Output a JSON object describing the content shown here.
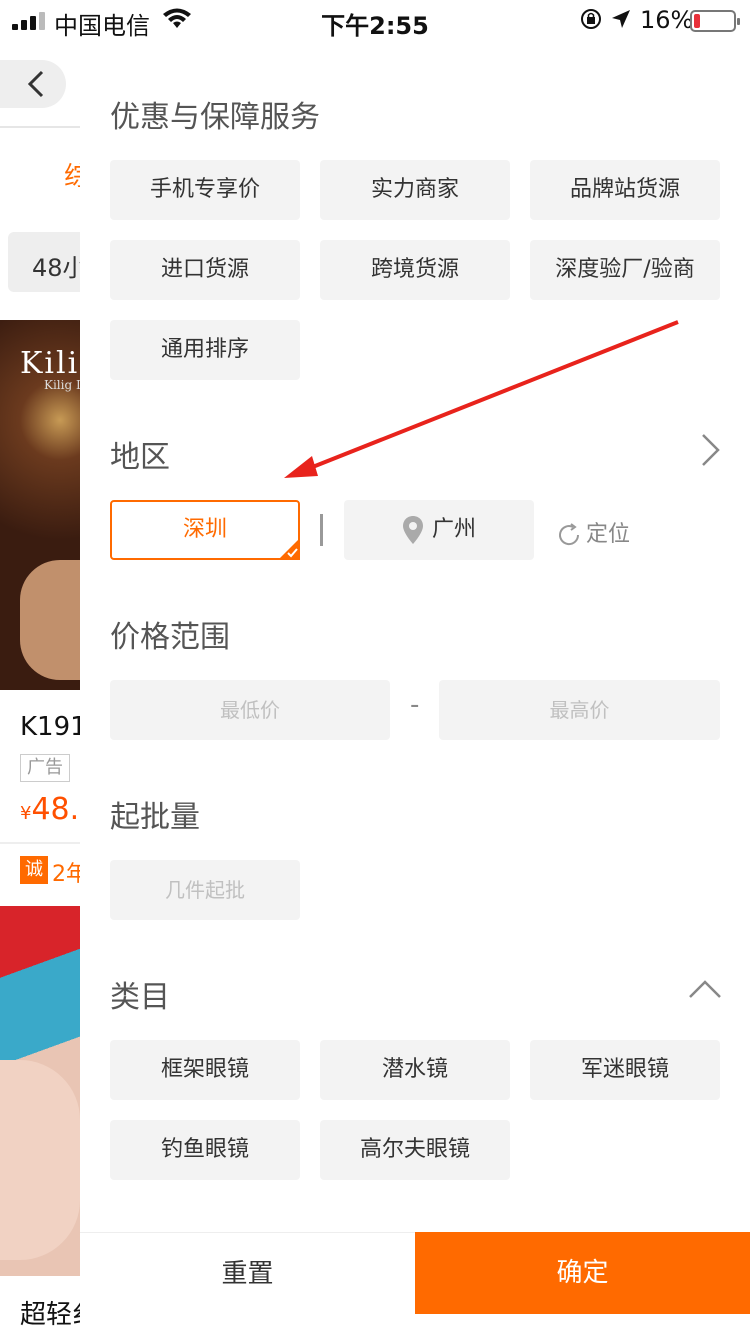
{
  "status_bar": {
    "carrier": "中国电信",
    "time": "下午2:55",
    "battery": "16%"
  },
  "background_page": {
    "tab_partial": "综",
    "filter_partial": "48小",
    "product1_title": "K191",
    "product1_brand": "Kilig",
    "product1_brand_sub": "Kilig L",
    "ad_label": "广告",
    "price_symbol": "¥",
    "price": "48.",
    "cheng_label": "诚",
    "years": "2年",
    "product2_title": "超轻纟"
  },
  "panel": {
    "service": {
      "title": "优惠与保障服务",
      "options": [
        "手机专享价",
        "实力商家",
        "品牌站货源",
        "进口货源",
        "跨境货源",
        "深度验厂/验商",
        "通用排序"
      ]
    },
    "region": {
      "title": "地区",
      "selected": "深圳",
      "located_city": "广州",
      "relocate_label": "定位"
    },
    "price_range": {
      "title": "价格范围",
      "min_placeholder": "最低价",
      "max_placeholder": "最高价",
      "separator": "-"
    },
    "min_order": {
      "title": "起批量",
      "placeholder": "几件起批"
    },
    "category": {
      "title": "类目",
      "options": [
        "框架眼镜",
        "潜水镜",
        "军迷眼镜",
        "钓鱼眼镜",
        "高尔夫眼镜"
      ]
    },
    "footer": {
      "reset_label": "重置",
      "confirm_label": "确定"
    }
  },
  "colors": {
    "accent": "#ff6a00",
    "chip_bg": "#f3f3f3",
    "annotation": "#e8231c"
  }
}
